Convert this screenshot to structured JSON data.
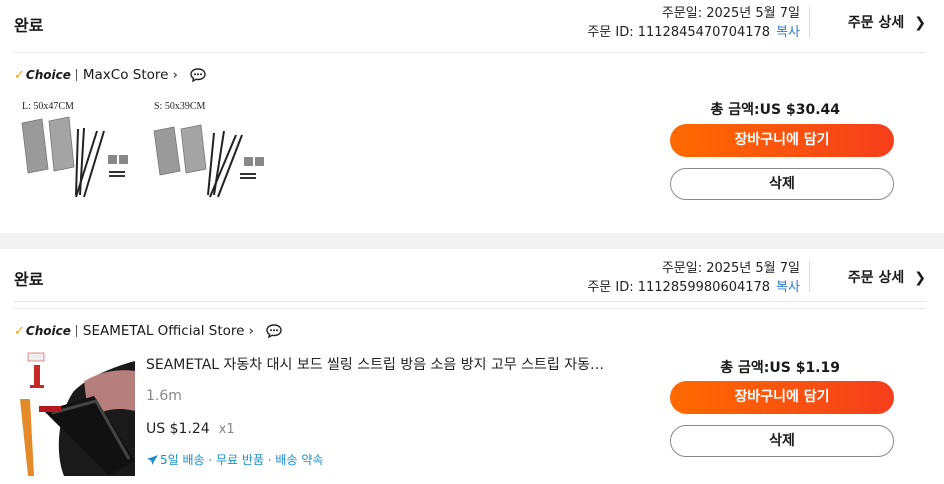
{
  "orders": [
    {
      "status": "완료",
      "order_date": "주문일: 2025년 5월 7일",
      "order_id": "주문 ID: 1112845470704178",
      "copy_label": "복사",
      "detail_label": "주문 상세",
      "choice_label": "Choice",
      "store_name": "MaxCo Store",
      "product_image_labels": [
        "L:  50x47CM",
        "S:  50x39CM"
      ],
      "total": "총 금액:US $30.44",
      "cart_label": "장바구니에 담기",
      "delete_label": "삭제"
    },
    {
      "status": "완료",
      "order_date": "주문일: 2025년 5월 7일",
      "order_id": "주문 ID: 1112859980604178",
      "copy_label": "복사",
      "detail_label": "주문 상세",
      "choice_label": "Choice",
      "store_name": "SEAMETAL Official Store",
      "product_title": "SEAMETAL 자동차 대시 보드 씰링 스트립 방음 소음 방지 고무 스트립 자동차 인...",
      "variant": "1.6m",
      "price": "US $1.24",
      "quantity": "x1",
      "shipping": "5일 배송 · 무료 반품 · 배송 약속",
      "total": "총 금액:US $1.19",
      "cart_label": "장바구니에 담기",
      "delete_label": "삭제"
    }
  ],
  "colors": {
    "accent_gradient_start": "#ff6a00",
    "accent_gradient_end": "#f53e1c",
    "link_blue": "#2e7bd6",
    "shipping_blue": "#1a8ecc",
    "choice_check": "#f7a500",
    "section_gap": "#f2f2f2"
  },
  "icons": [
    "chevron-right-icon",
    "chat-bubble-icon",
    "check-icon",
    "plane-icon"
  ]
}
